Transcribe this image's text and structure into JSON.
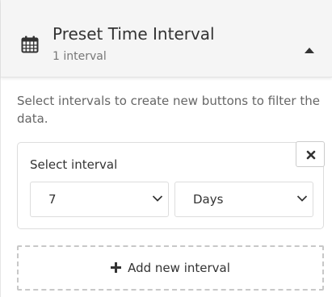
{
  "header": {
    "title": "Preset Time Interval",
    "subtitle": "1 interval",
    "icon": "calendar-icon",
    "toggle_icon": "caret-up-icon"
  },
  "body": {
    "description": "Select intervals to create new buttons to filter the data."
  },
  "interval": {
    "label": "Select interval",
    "count_value": "7",
    "unit_value": "Days",
    "remove_icon": "close-icon"
  },
  "add_button": {
    "label": "Add new interval",
    "icon": "plus-icon"
  },
  "colors": {
    "header_bg": "#f5f5f5",
    "text": "#333333",
    "muted_text": "#777777",
    "border": "#dddddd",
    "dashed_border": "#c8c8c8"
  }
}
